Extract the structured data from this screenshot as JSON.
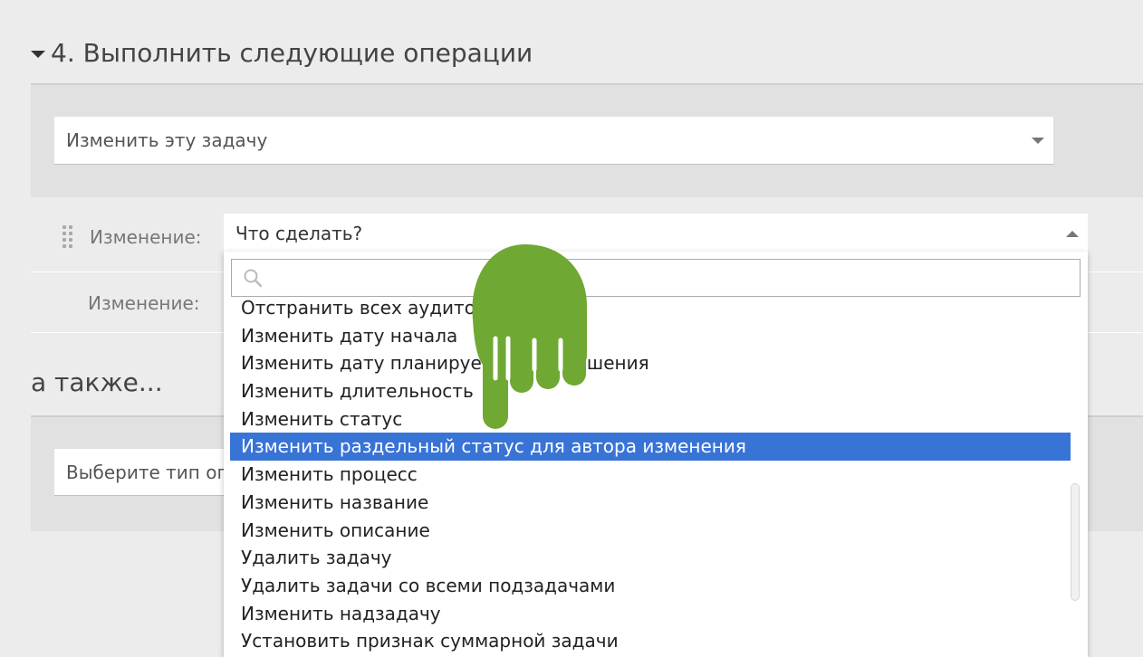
{
  "section": {
    "title": "4. Выполнить следующие операции"
  },
  "action_select": {
    "value": "Изменить эту задачу"
  },
  "change_row_1": {
    "label": "Изменение:",
    "select_value": "Что сделать?"
  },
  "change_row_2": {
    "label": "Изменение:"
  },
  "also": {
    "title": "а также..."
  },
  "type_select": {
    "value": "Выберите тип оп"
  },
  "dropdown": {
    "search_placeholder": "",
    "options": [
      "Отстранить всех аудиторов",
      "Изменить дату начала",
      "Изменить дату планируемого завершения",
      "Изменить длительность",
      "Изменить статус",
      "Изменить раздельный статус для автора изменения",
      "Изменить процесс",
      "Изменить название",
      "Изменить описание",
      "Удалить задачу",
      "Удалить задачи со всеми подзадачами",
      "Изменить надзадачу",
      "Установить признак суммарной задачи"
    ],
    "highlighted_index": 5
  },
  "colors": {
    "highlight": "#3873d6",
    "hand": "#6fa832"
  }
}
